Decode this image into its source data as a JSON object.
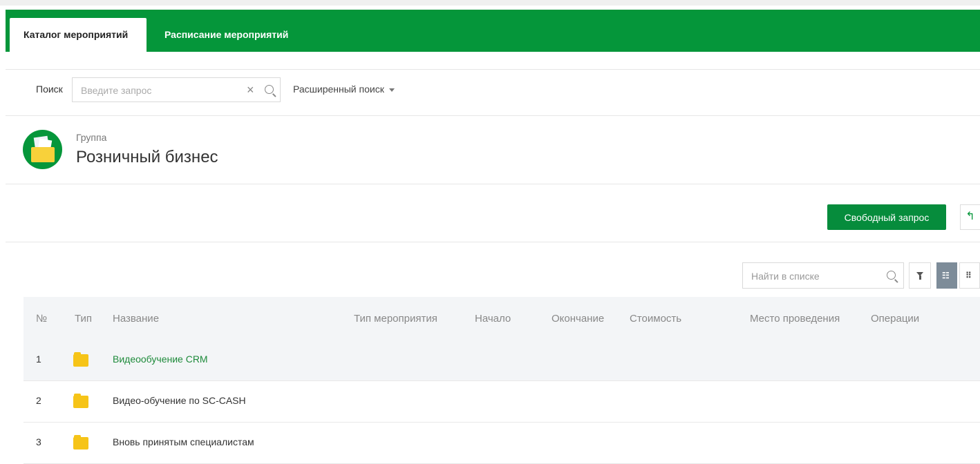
{
  "tabs": [
    {
      "label": "Каталог мероприятий",
      "active": true
    },
    {
      "label": "Расписание мероприятий",
      "active": false
    }
  ],
  "search": {
    "label": "Поиск",
    "placeholder": "Введите запрос",
    "value": "",
    "advanced_label": "Расширенный поиск"
  },
  "group": {
    "caption": "Группа",
    "title": "Розничный бизнес"
  },
  "actions": {
    "free_request_label": "Свободный запрос"
  },
  "list_toolbar": {
    "search_placeholder": "Найти в списке"
  },
  "table": {
    "headers": {
      "num": "№",
      "type": "Тип",
      "name": "Название",
      "event_type": "Тип мероприятия",
      "start": "Начало",
      "end": "Окончание",
      "cost": "Стоимость",
      "place": "Место проведения",
      "ops": "Операции"
    },
    "rows": [
      {
        "num": "1",
        "name": "Видеообучение CRM"
      },
      {
        "num": "2",
        "name": "Видео-обучение по SC-CASH"
      },
      {
        "num": "3",
        "name": "Вновь принятым специалистам"
      }
    ]
  },
  "colors": {
    "brand_green": "#05963a",
    "link_green": "#1d8a3a",
    "folder_yellow": "#f6c418"
  }
}
